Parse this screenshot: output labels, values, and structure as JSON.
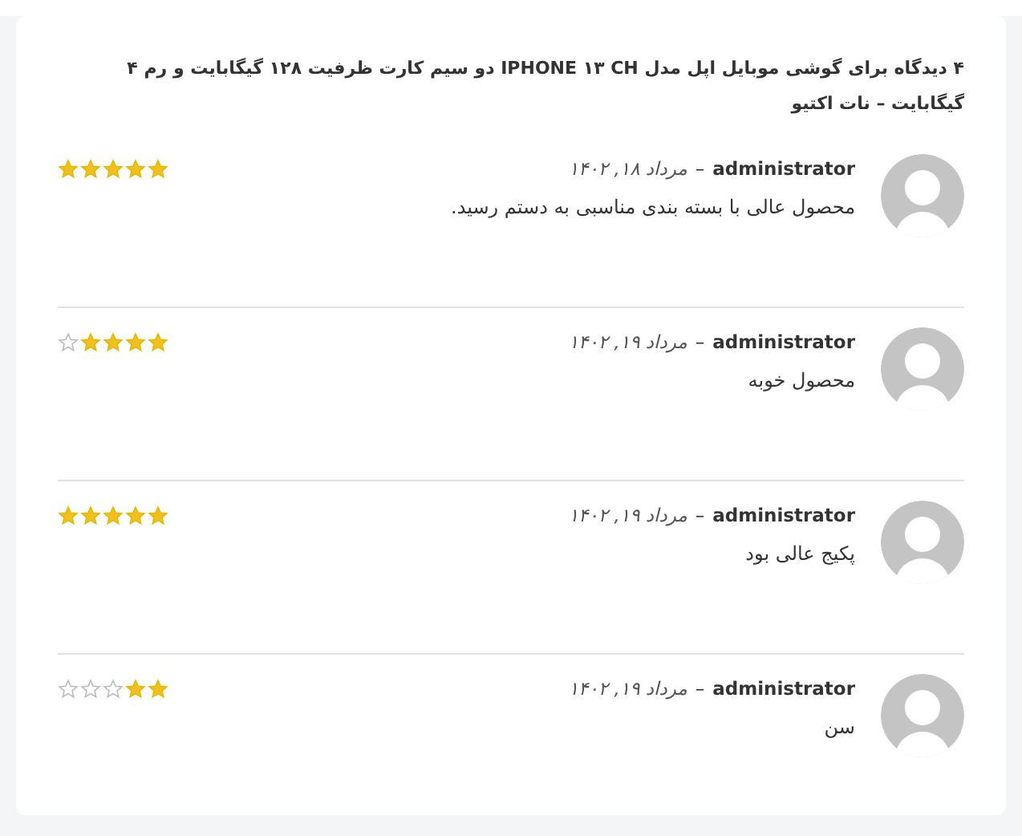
{
  "title": "۴ دیدگاه برای گوشی موبایل اپل مدل IPHONE ۱۳ CH دو سیم کارت ظرفیت ۱۲۸ گیگابایت و رم ۴ گیگابایت – نات اکتیو",
  "reviews": [
    {
      "author": "administrator",
      "separator": "–",
      "date": "مرداد ۱۸, ۱۴۰۲",
      "text": "محصول عالی با بسته بندی مناسبی به دستم رسید.",
      "stars": 5
    },
    {
      "author": "administrator",
      "separator": "–",
      "date": "مرداد ۱۹, ۱۴۰۲",
      "text": "محصول خوبه",
      "stars": 4
    },
    {
      "author": "administrator",
      "separator": "–",
      "date": "مرداد ۱۹, ۱۴۰۲",
      "text": "پکیج عالی بود",
      "stars": 5
    },
    {
      "author": "administrator",
      "separator": "–",
      "date": "مرداد ۱۹, ۱۴۰۲",
      "text": "سن",
      "stars": 2
    }
  ]
}
